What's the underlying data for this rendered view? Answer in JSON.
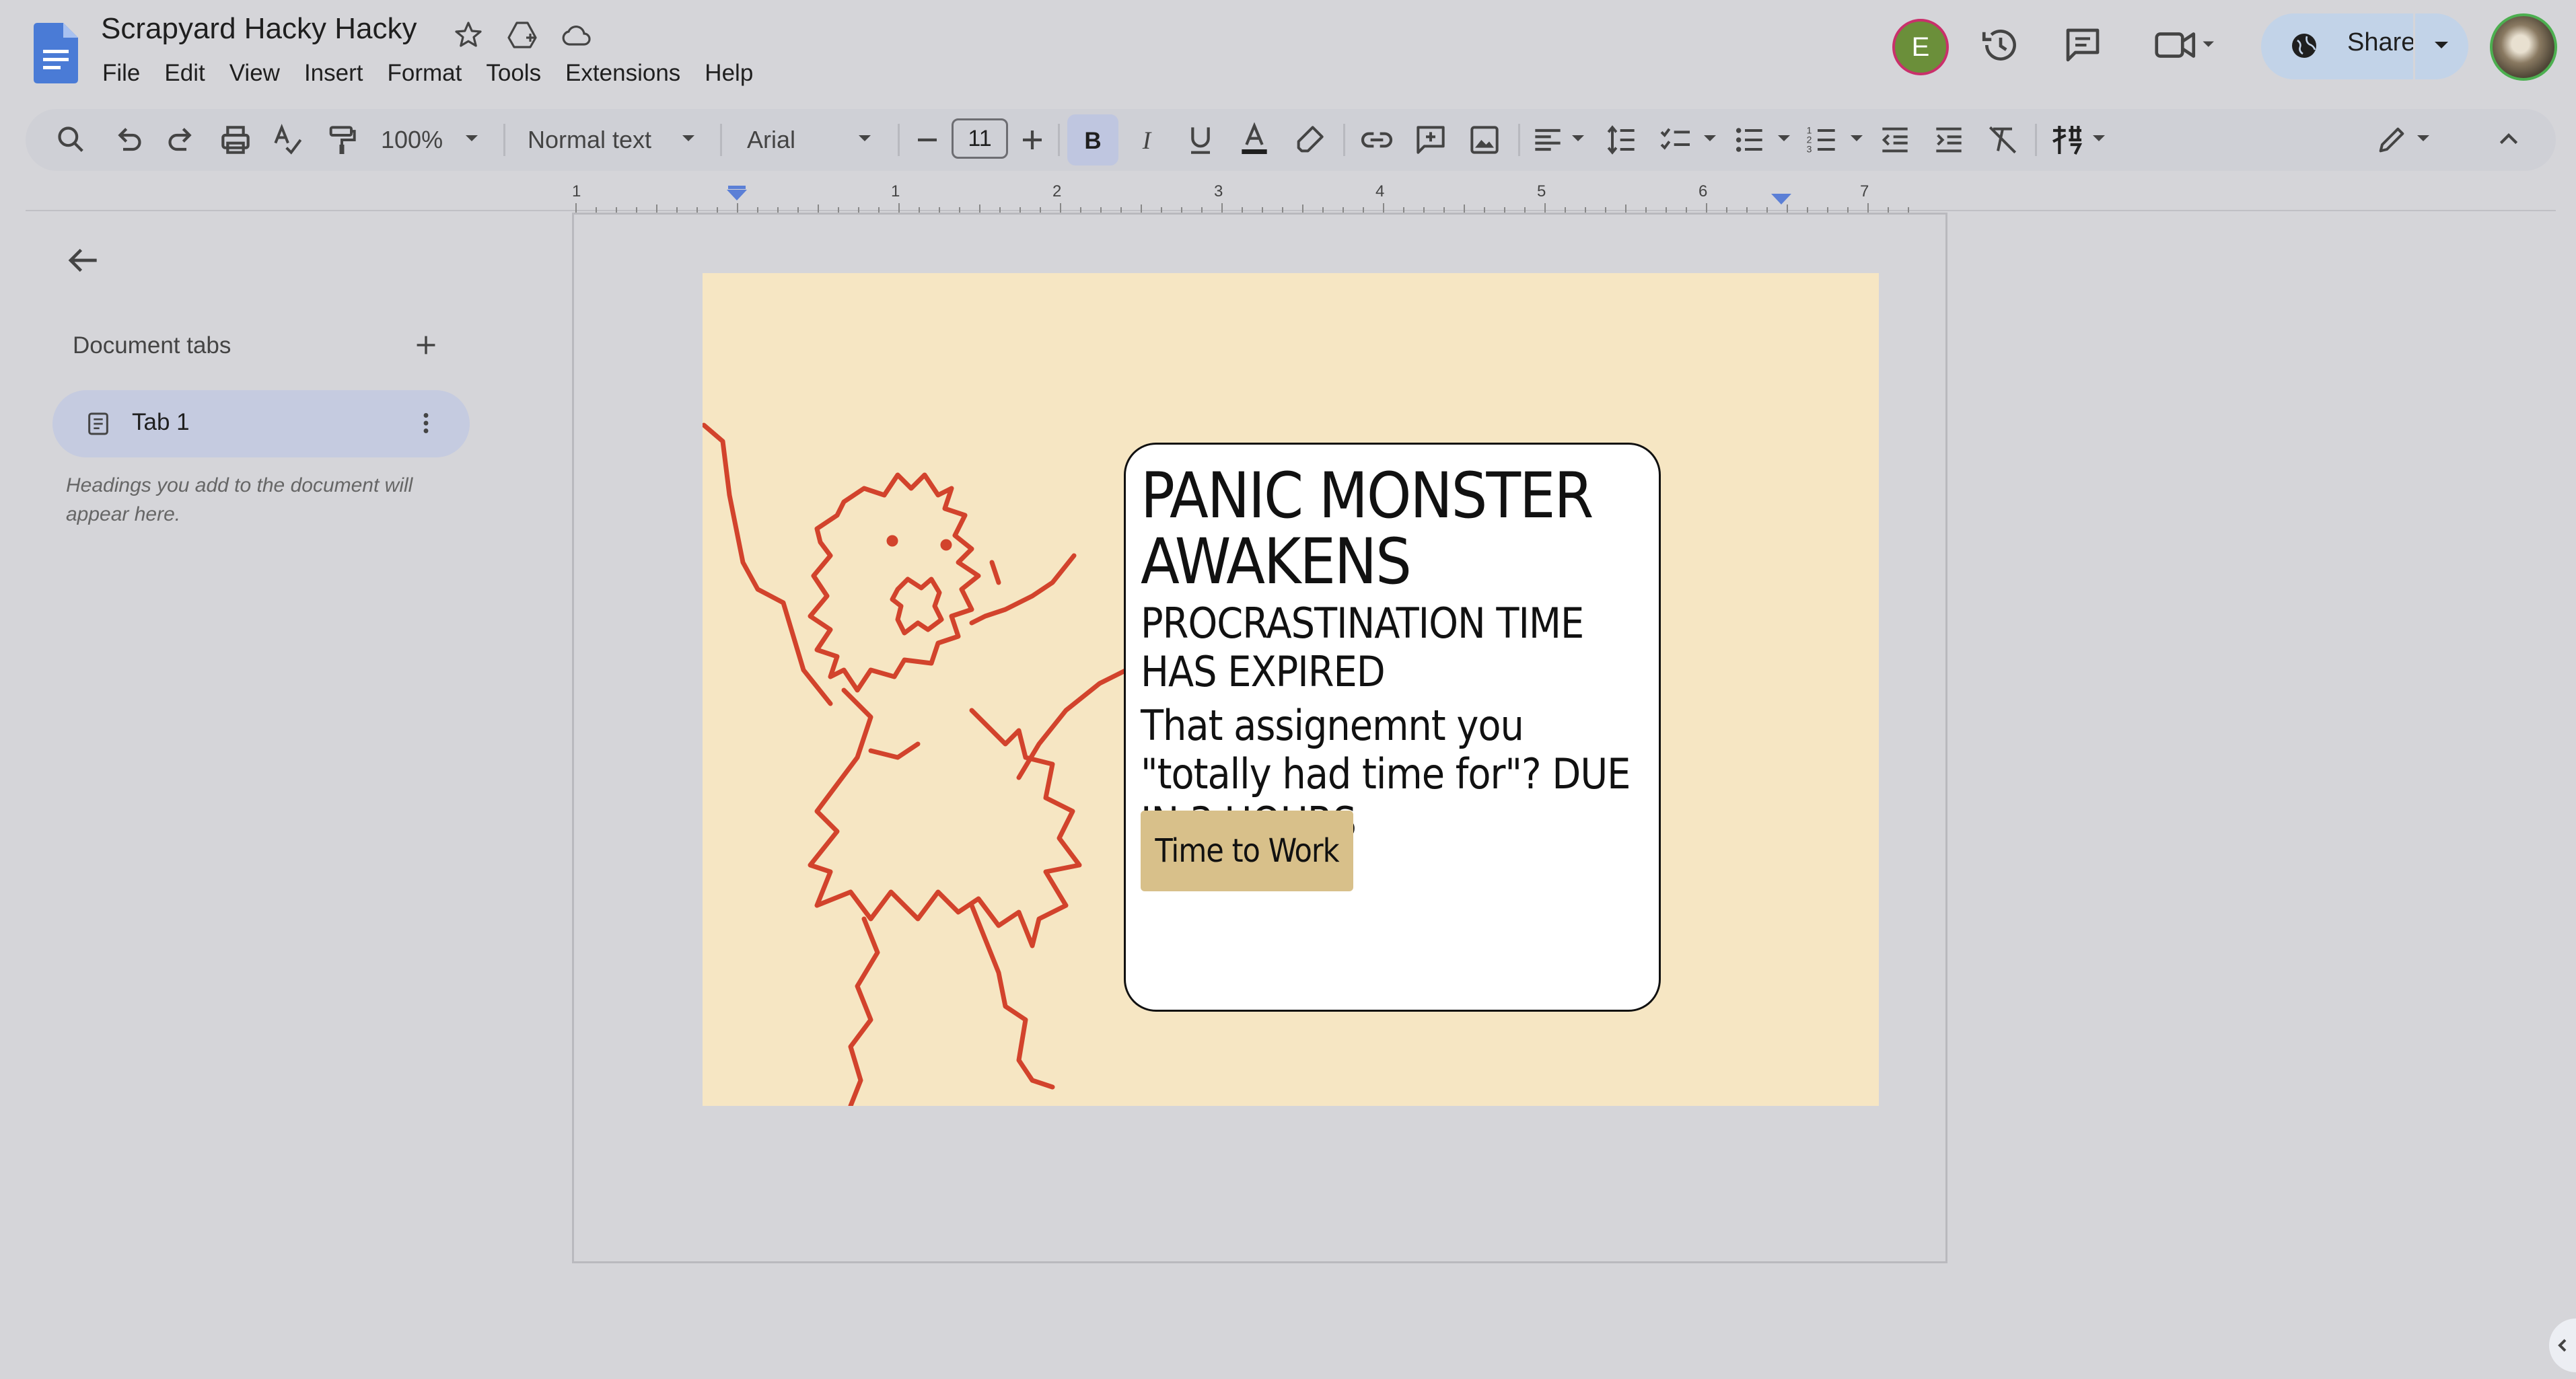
{
  "app": {
    "title": "Scrapyard Hacky Hacky",
    "menus": [
      "File",
      "Edit",
      "View",
      "Insert",
      "Format",
      "Tools",
      "Extensions",
      "Help"
    ],
    "account_initial": "E",
    "share_label": "Share"
  },
  "toolbar": {
    "zoom": "100%",
    "style": "Normal text",
    "font": "Arial",
    "font_size": "11",
    "text_color": "#1f1f1f",
    "icons": [
      "search-icon",
      "undo-icon",
      "redo-icon",
      "print-icon",
      "spellcheck-icon",
      "paint-format-icon",
      "bold-icon",
      "italic-icon",
      "underline-icon",
      "text-color-icon",
      "highlight-icon",
      "link-icon",
      "comment-icon",
      "image-icon",
      "align-icon",
      "line-spacing-icon",
      "checklist-icon",
      "bullet-list-icon",
      "numbered-list-icon",
      "indent-decrease-icon",
      "indent-increase-icon",
      "clear-format-icon",
      "input-tools-icon",
      "editing-mode-icon",
      "collapse-icon"
    ]
  },
  "ruler": {
    "labels": [
      "1",
      "1",
      "2",
      "3",
      "4",
      "5",
      "6",
      "7"
    ]
  },
  "sidebar": {
    "heading": "Document tabs",
    "tabs": [
      {
        "label": "Tab 1"
      }
    ],
    "hint": "Headings you add to the document will appear here."
  },
  "document": {
    "card": {
      "title": "PANIC MONSTER AWAKENS",
      "subtitle": "PROCRASTINATION TIME HAS EXPIRED",
      "body": "That assignemnt you \"totally had time for\"? DUE IN 3 HOURS",
      "button_label": "Time to Work"
    },
    "colors": {
      "background": "#f6e6c3",
      "monster_stroke": "#d2432c",
      "button": "#d8c08a"
    }
  }
}
